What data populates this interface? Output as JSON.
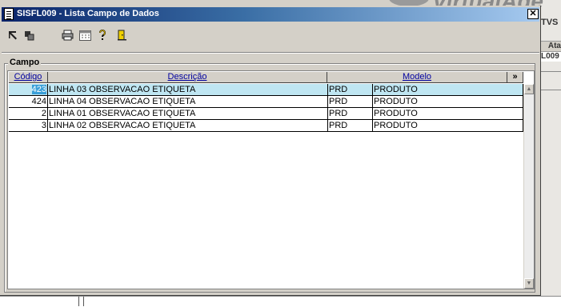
{
  "window": {
    "title": "SISFL009 - Lista Campo de Dados",
    "close_label": "✕"
  },
  "background": {
    "logo_fragment": "VirtualAge",
    "cell_1": "TVS",
    "cell_2": "Ata",
    "cell_3": "L009"
  },
  "toolbar": {
    "icons": [
      "first-record-icon",
      "copy-icon",
      "print-icon",
      "calendar-icon",
      "help-icon",
      "exit-door-icon"
    ]
  },
  "group": {
    "label": "Campo"
  },
  "grid": {
    "columns": {
      "codigo": "Código",
      "descricao": "Descrição",
      "modelo": "Modelo",
      "more": "»"
    },
    "rows": [
      {
        "codigo": "423",
        "descricao": "LINHA 03 OBSERVACAO ETIQUETA",
        "tipo": "PRD",
        "modelo": "PRODUTO",
        "selected": true
      },
      {
        "codigo": "424",
        "descricao": "LINHA 04 OBSERVACAO ETIQUETA",
        "tipo": "PRD",
        "modelo": "PRODUTO"
      },
      {
        "codigo": "2",
        "descricao": "LINHA 01 OBSERVACAO ETIQUETA",
        "tipo": "PRD",
        "modelo": "PRODUTO"
      },
      {
        "codigo": "3",
        "descricao": "LINHA 02 OBSERVACAO ETIQUETA",
        "tipo": "PRD",
        "modelo": "PRODUTO"
      }
    ]
  }
}
